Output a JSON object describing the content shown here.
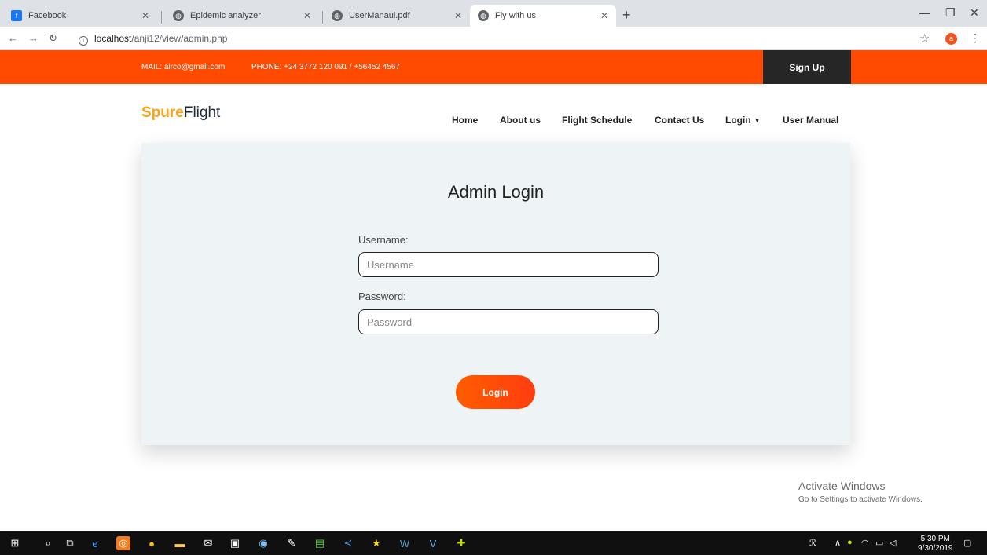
{
  "browser": {
    "tabs": [
      {
        "title": "Facebook",
        "icon": "facebook-icon"
      },
      {
        "title": "Epidemic analyzer",
        "icon": "globe-icon"
      },
      {
        "title": "UserManaul.pdf",
        "icon": "globe-icon"
      },
      {
        "title": "Fly with us",
        "icon": "globe-icon"
      }
    ],
    "url_host": "localhost",
    "url_path": "/anji12/view/admin.php",
    "profile_initial": "a"
  },
  "topbar": {
    "mail": "MAIL: airco@gmail.com",
    "phone": "PHONE: +24 3772 120 091 / +56452 4567",
    "signup_label": "Sign Up"
  },
  "brand": {
    "part1": "Spure",
    "part2": "Flight"
  },
  "nav": {
    "home": "Home",
    "about": "About us",
    "schedule": "Flight Schedule",
    "contact": "Contact Us",
    "login": "Login",
    "manual": "User Manual"
  },
  "form": {
    "title": "Admin Login",
    "username_label": "Username:",
    "username_placeholder": "Username",
    "password_label": "Password:",
    "password_placeholder": "Password",
    "submit_label": "Login"
  },
  "watermark": {
    "line1": "Activate Windows",
    "line2": "Go to Settings to activate Windows."
  },
  "taskbar": {
    "time": "5:30 PM",
    "date": "9/30/2019"
  },
  "colors": {
    "accent": "#ff4a02",
    "brand_yellow": "#f8a31a",
    "signup_bg": "#262626",
    "card_bg": "#eef4f6"
  }
}
